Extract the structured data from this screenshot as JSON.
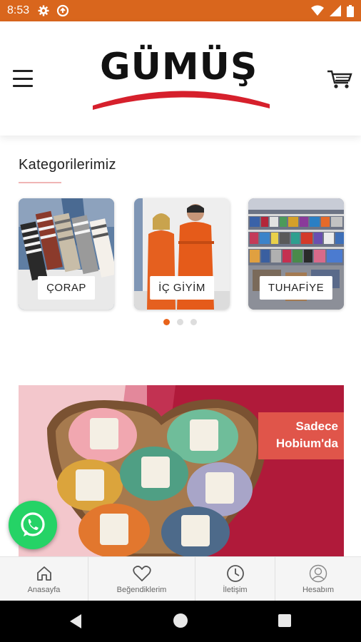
{
  "status_bar": {
    "time": "8:53",
    "icons": [
      "gear-icon",
      "data-saver-icon",
      "wifi-icon",
      "signal-icon",
      "battery-icon"
    ]
  },
  "header": {
    "logo_text": "GÜMÜŞ",
    "menu_icon": "hamburger-icon",
    "cart_icon": "cart-icon"
  },
  "categories": {
    "title": "Kategorilerimiz",
    "items": [
      {
        "label": "ÇORAP"
      },
      {
        "label": "İÇ GİYİM"
      },
      {
        "label": "TUHAFİYE"
      }
    ],
    "pagination": {
      "total": 3,
      "active": 1
    }
  },
  "banner": {
    "badge_line1": "Sadece",
    "badge_line2": "Hobium'da"
  },
  "bottom_nav": {
    "items": [
      {
        "label": "Anasayfa",
        "icon": "home-icon"
      },
      {
        "label": "Beğendiklerim",
        "icon": "heart-icon"
      },
      {
        "label": "İletişim",
        "icon": "clock-icon"
      },
      {
        "label": "Hesabım",
        "icon": "user-icon"
      }
    ]
  },
  "colors": {
    "status_bar": "#d9661d",
    "accent": "#e8631a",
    "logo_swoosh": "#d6202c",
    "whatsapp": "#25d366",
    "banner_badge": "#e0554a"
  }
}
